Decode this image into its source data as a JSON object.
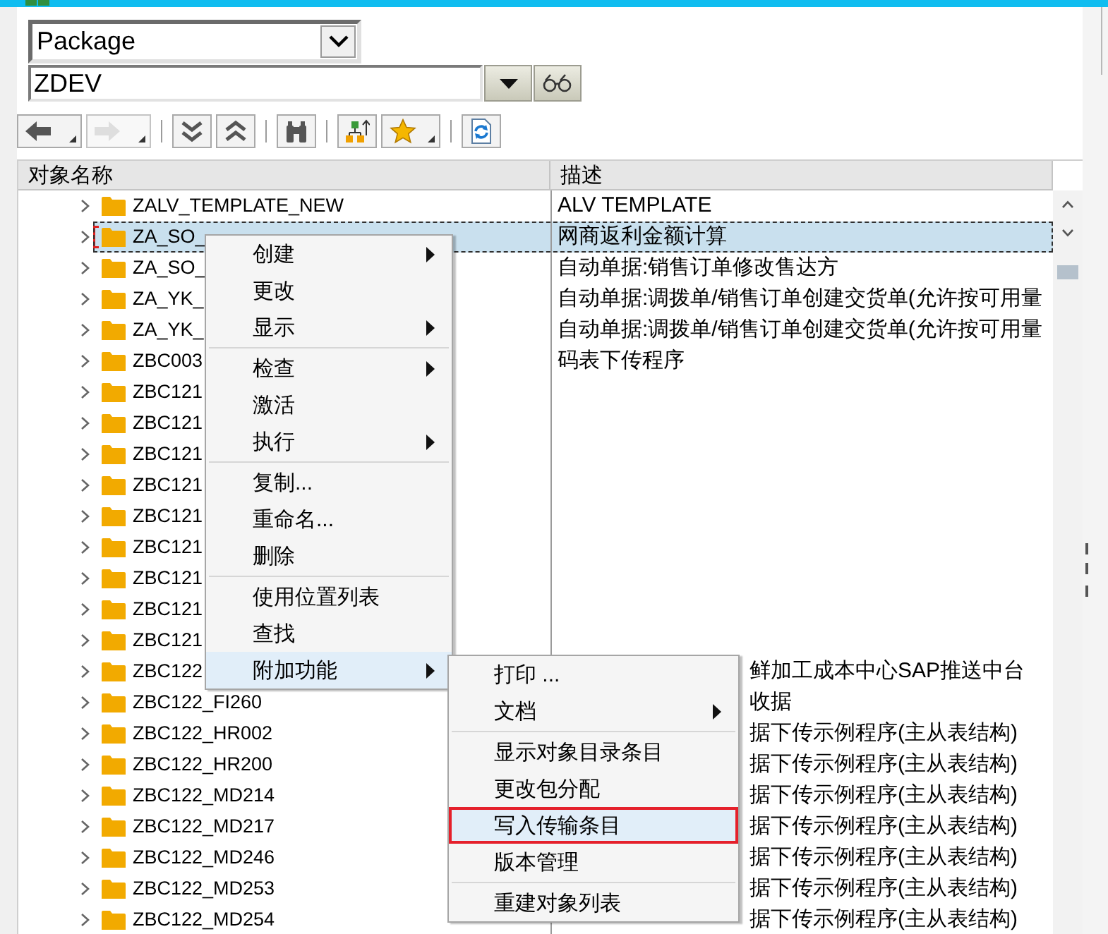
{
  "object_type_select": {
    "value": "Package"
  },
  "object_name_field": {
    "value": "ZDEV"
  },
  "toolbar": [
    {
      "kind": "back",
      "disabled": false,
      "has_menu": true
    },
    {
      "kind": "forward",
      "disabled": true,
      "has_menu": true
    },
    {
      "kind": "separator"
    },
    {
      "kind": "expand_all",
      "disabled": false,
      "has_menu": false
    },
    {
      "kind": "collapse_all",
      "disabled": false,
      "has_menu": false
    },
    {
      "kind": "separator"
    },
    {
      "kind": "find",
      "disabled": false,
      "has_menu": false
    },
    {
      "kind": "separator"
    },
    {
      "kind": "hierarchy",
      "disabled": false,
      "has_menu": false
    },
    {
      "kind": "favorites",
      "disabled": false,
      "has_menu": true
    },
    {
      "kind": "separator"
    },
    {
      "kind": "refresh",
      "disabled": false,
      "has_menu": false
    }
  ],
  "tree": {
    "columns": [
      "对象名称",
      "描述"
    ],
    "rows": [
      {
        "name": "ZALV_TEMPLATE_NEW",
        "description": "ALV TEMPLATE",
        "expanded": false,
        "selected": false
      },
      {
        "name": "ZA_SO_",
        "description": "网商返利金额计算",
        "expanded": false,
        "selected": true
      },
      {
        "name": "ZA_SO_",
        "description": "自动单据:销售订单修改售达方",
        "expanded": false,
        "selected": false
      },
      {
        "name": "ZA_YK_",
        "description": "自动单据:调拨单/销售订单创建交货单(允许按可用量",
        "expanded": false,
        "selected": false
      },
      {
        "name": "ZA_YK_",
        "description": "自动单据:调拨单/销售订单创建交货单(允许按可用量",
        "expanded": false,
        "selected": false
      },
      {
        "name": "ZBC003",
        "description": "码表下传程序",
        "expanded": false,
        "selected": false
      },
      {
        "name": "ZBC121",
        "expanded": false,
        "selected": false
      },
      {
        "name": "ZBC121",
        "expanded": false,
        "selected": false
      },
      {
        "name": "ZBC121",
        "expanded": false,
        "selected": false
      },
      {
        "name": "ZBC121",
        "expanded": false,
        "selected": false
      },
      {
        "name": "ZBC121",
        "expanded": false,
        "selected": false
      },
      {
        "name": "ZBC121",
        "expanded": false,
        "selected": false
      },
      {
        "name": "ZBC121",
        "expanded": false,
        "selected": false
      },
      {
        "name": "ZBC121",
        "expanded": false,
        "selected": false
      },
      {
        "name": "ZBC121",
        "expanded": false,
        "selected": false
      },
      {
        "name": "ZBC122",
        "description": "鲜加工成本中心SAP推送中台",
        "expanded": false,
        "selected": false
      },
      {
        "name": "ZBC122_FI260",
        "description": "收据",
        "expanded": false,
        "selected": false
      },
      {
        "name": "ZBC122_HR002",
        "description": "据下传示例程序(主从表结构)",
        "expanded": false,
        "selected": false
      },
      {
        "name": "ZBC122_HR200",
        "description": "据下传示例程序(主从表结构)",
        "expanded": false,
        "selected": false
      },
      {
        "name": "ZBC122_MD214",
        "description": "据下传示例程序(主从表结构)",
        "expanded": false,
        "selected": false
      },
      {
        "name": "ZBC122_MD217",
        "description": "据下传示例程序(主从表结构)",
        "expanded": false,
        "selected": false
      },
      {
        "name": "ZBC122_MD246",
        "description": "据下传示例程序(主从表结构)",
        "expanded": false,
        "selected": false
      },
      {
        "name": "ZBC122_MD253",
        "description": "据下传示例程序(主从表结构)",
        "expanded": false,
        "selected": false
      },
      {
        "name": "ZBC122_MD254",
        "description": "据下传示例程序(主从表结构)",
        "expanded": false,
        "selected": false
      }
    ]
  },
  "context_menu": {
    "items": [
      {
        "kind": "item",
        "label": "创建",
        "has_submenu": true,
        "selected": false
      },
      {
        "kind": "item",
        "label": "更改",
        "has_submenu": false,
        "selected": false
      },
      {
        "kind": "item",
        "label": "显示",
        "has_submenu": true,
        "selected": false
      },
      {
        "kind": "separator"
      },
      {
        "kind": "item",
        "label": "检查",
        "has_submenu": true,
        "selected": false
      },
      {
        "kind": "item",
        "label": "激活",
        "has_submenu": false,
        "selected": false
      },
      {
        "kind": "item",
        "label": "执行",
        "has_submenu": true,
        "selected": false
      },
      {
        "kind": "separator"
      },
      {
        "kind": "item",
        "label": "复制...",
        "has_submenu": false,
        "selected": false
      },
      {
        "kind": "item",
        "label": "重命名...",
        "has_submenu": false,
        "selected": false
      },
      {
        "kind": "item",
        "label": "删除",
        "has_submenu": false,
        "selected": false
      },
      {
        "kind": "separator"
      },
      {
        "kind": "item",
        "label": "使用位置列表",
        "has_submenu": false,
        "selected": false
      },
      {
        "kind": "item",
        "label": "查找",
        "has_submenu": false,
        "selected": false
      },
      {
        "kind": "item",
        "label": "附加功能",
        "has_submenu": true,
        "selected": true
      }
    ]
  },
  "submenu": {
    "items": [
      {
        "kind": "item",
        "label": "打印 ...",
        "has_submenu": false,
        "selected": false,
        "annotated": false
      },
      {
        "kind": "item",
        "label": "文档",
        "has_submenu": true,
        "selected": false,
        "annotated": false
      },
      {
        "kind": "separator"
      },
      {
        "kind": "item",
        "label": "显示对象目录条目",
        "has_submenu": false,
        "selected": false,
        "annotated": false
      },
      {
        "kind": "item",
        "label": "更改包分配",
        "has_submenu": false,
        "selected": false,
        "annotated": false
      },
      {
        "kind": "item",
        "label": "写入传输条目",
        "has_submenu": false,
        "selected": true,
        "annotated": true
      },
      {
        "kind": "item",
        "label": "版本管理",
        "has_submenu": false,
        "selected": false,
        "annotated": false
      },
      {
        "kind": "separator"
      },
      {
        "kind": "item",
        "label": "重建对象列表",
        "has_submenu": false,
        "selected": false,
        "annotated": false
      }
    ]
  }
}
